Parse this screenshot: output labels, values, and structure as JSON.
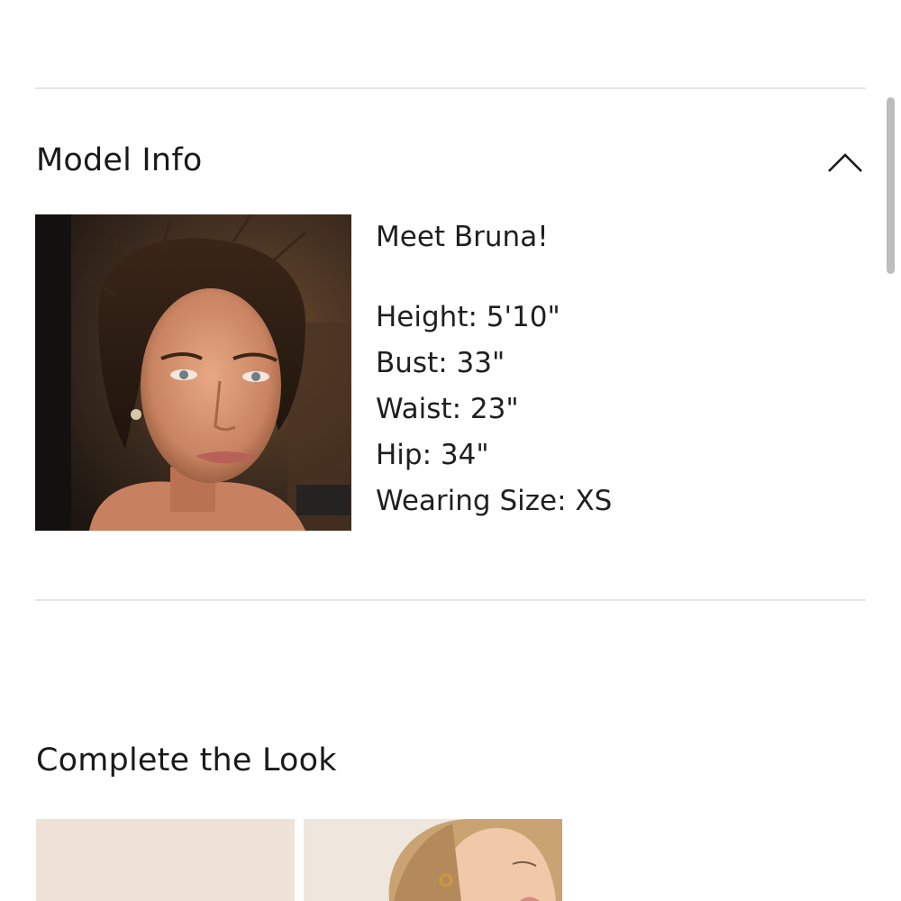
{
  "model_info": {
    "title": "Model Info",
    "intro": "Meet Bruna!",
    "stats": [
      {
        "label": "Height",
        "value": "5'10\""
      },
      {
        "label": "Bust",
        "value": "33\""
      },
      {
        "label": "Waist",
        "value": "23\""
      },
      {
        "label": "Hip",
        "value": "34\""
      },
      {
        "label": "Wearing Size",
        "value": "XS"
      }
    ],
    "stats_text": [
      "Height: 5'10\"",
      "Bust: 33\"",
      "Waist: 23\"",
      "Hip: 34\"",
      "Wearing Size: XS"
    ],
    "toggle_icon": "chevron-up-icon"
  },
  "complete_the_look": {
    "title": "Complete the Look"
  },
  "colors": {
    "divider": "#e6e6e6",
    "text": "#1f1f1f",
    "scrollbar": "#bdbdbd"
  }
}
